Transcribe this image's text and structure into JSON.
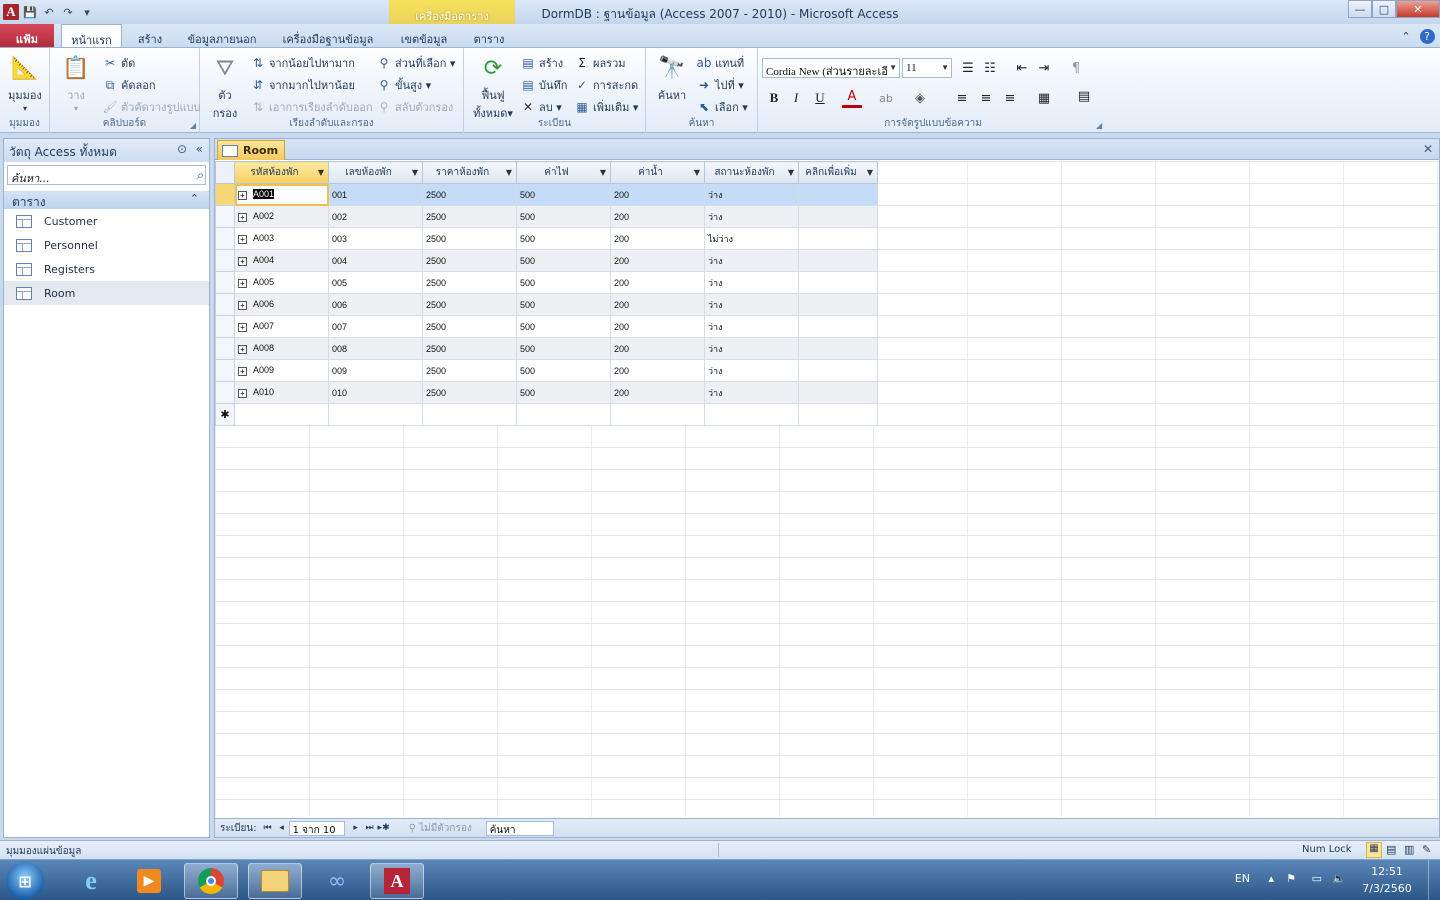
{
  "window": {
    "title": "DormDB : ฐานข้อมูล (Access 2007 - 2010) - Microsoft Access",
    "context_tab": "เครื่องมือตาราง",
    "app_icon": "A",
    "close": "✕",
    "maximize": "□",
    "minimize": "—"
  },
  "ribbon_tabs": [
    "แฟ้ม",
    "หน้าแรก",
    "สร้าง",
    "ข้อมูลภายนอก",
    "เครื่องมือฐานข้อมูล",
    "เขตข้อมูล",
    "ตาราง"
  ],
  "ribbon": {
    "views": {
      "label": "มุมมอง",
      "button": "มุมมอง"
    },
    "clipboard": {
      "label": "คลิปบอร์ด",
      "paste": "วาง",
      "cut": "ตัด",
      "copy": "คัดลอก",
      "format_painter": "ตัวคัดวางรูปแบบ"
    },
    "sort_filter": {
      "label": "เรียงลำดับและกรอง",
      "filter": "ตัว\nกรอง",
      "filter_1": "ตัว",
      "filter_2": "กรอง",
      "ascending": "จากน้อยไปหามาก",
      "descending": "จากมากไปหาน้อย",
      "remove_sort": "เอาการเรียงลำดับออก",
      "selection": "ส่วนที่เลือก",
      "advanced": "ขั้นสูง",
      "toggle_filter": "สลับตัวกรอง"
    },
    "records": {
      "label": "ระเบียน",
      "refresh_1": "ฟื้นฟู",
      "refresh_2": "ทั้งหมด",
      "new": "สร้าง",
      "save": "บันทึก",
      "delete": "ลบ",
      "totals": "ผลรวม",
      "spelling": "การสะกด",
      "more": "เพิ่มเติม"
    },
    "find": {
      "label": "ค้นหา",
      "find": "ค้นหา",
      "replace": "แทนที่",
      "goto": "ไปที่",
      "select": "เลือก"
    },
    "text_format": {
      "label": "การจัดรูปแบบข้อความ",
      "font": "Cordia New (ส่วนรายละเอี",
      "size": "11"
    }
  },
  "nav": {
    "header": "วัตถุ Access ทั้งหมด",
    "search_placeholder": "ค้นหา...",
    "group": "ตาราง",
    "items": [
      "Customer",
      "Personnel",
      "Registers",
      "Room"
    ],
    "selected": "Room"
  },
  "doc": {
    "tab": "Room"
  },
  "table": {
    "columns": [
      "รหัสห้องพัก",
      "เลขห้องพัก",
      "ราคาห้องพัก",
      "ค่าไฟ",
      "ค่าน้ำ",
      "สถานะห้องพัก",
      "คลิกเพื่อเพิ่ม"
    ],
    "rows": [
      [
        "A001",
        "001",
        "2500",
        "500",
        "200",
        "ว่าง",
        ""
      ],
      [
        "A002",
        "002",
        "2500",
        "500",
        "200",
        "ว่าง",
        ""
      ],
      [
        "A003",
        "003",
        "2500",
        "500",
        "200",
        "ไม่ว่าง",
        ""
      ],
      [
        "A004",
        "004",
        "2500",
        "500",
        "200",
        "ว่าง",
        ""
      ],
      [
        "A005",
        "005",
        "2500",
        "500",
        "200",
        "ว่าง",
        ""
      ],
      [
        "A006",
        "006",
        "2500",
        "500",
        "200",
        "ว่าง",
        ""
      ],
      [
        "A007",
        "007",
        "2500",
        "500",
        "200",
        "ว่าง",
        ""
      ],
      [
        "A008",
        "008",
        "2500",
        "500",
        "200",
        "ว่าง",
        ""
      ],
      [
        "A009",
        "009",
        "2500",
        "500",
        "200",
        "ว่าง",
        ""
      ],
      [
        "A010",
        "010",
        "2500",
        "500",
        "200",
        "ว่าง",
        ""
      ]
    ],
    "new_row_marker": "✱"
  },
  "record_nav": {
    "label": "ระเบียน:",
    "position": "1 จาก 10",
    "filter": "ไม่มีตัวกรอง",
    "search": "ค้นหา"
  },
  "status": {
    "left": "มุมมองแผ่นข้อมูล",
    "numlock": "Num Lock"
  },
  "taskbar": {
    "lang": "EN",
    "time": "12:51",
    "date": "7/3/2560"
  }
}
